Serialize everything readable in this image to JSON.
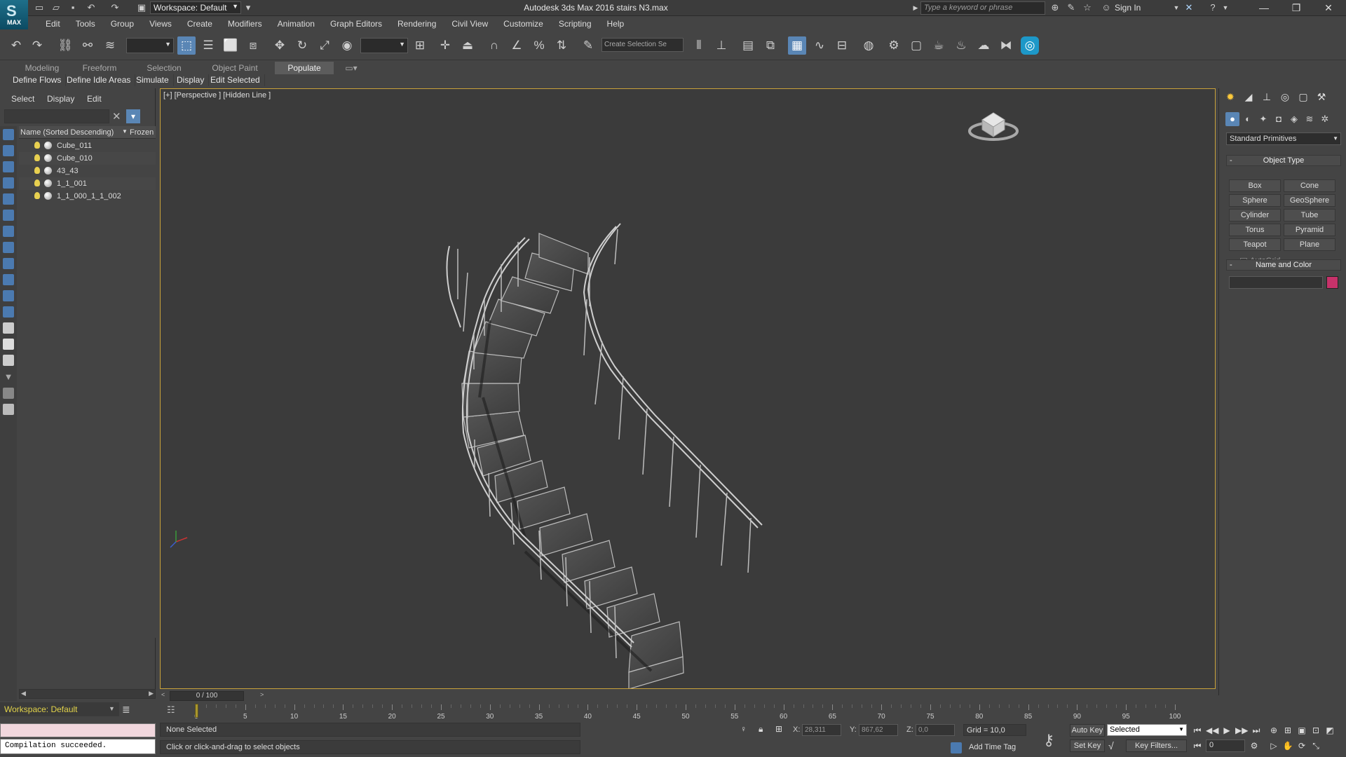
{
  "app": {
    "logo_text": "MAX",
    "title": "Autodesk 3ds Max 2016     stairs N3.max",
    "workspace": "Workspace: Default",
    "search_placeholder": "Type a keyword or phrase",
    "sign_in": "Sign In"
  },
  "menu": [
    "Edit",
    "Tools",
    "Group",
    "Views",
    "Create",
    "Modifiers",
    "Animation",
    "Graph Editors",
    "Rendering",
    "Civil View",
    "Customize",
    "Scripting",
    "Help"
  ],
  "toolbar": {
    "selection_set_placeholder": "Create Selection Se"
  },
  "ribbon": {
    "tabs": [
      "Modeling",
      "Freeform",
      "Selection",
      "Object Paint",
      "Populate"
    ],
    "active_tab": "Populate",
    "buttons": [
      "Define Flows",
      "Define Idle Areas",
      "Simulate",
      "Display",
      "Edit Selected"
    ]
  },
  "scene_explorer": {
    "menus": [
      "Select",
      "Display",
      "Edit"
    ],
    "column_name": "Name (Sorted Descending)",
    "column_frozen": "Frozen",
    "objects": [
      "Cube_011",
      "Cube_010",
      "43_43",
      "1_1_001",
      "1_1_000_1_1_002"
    ],
    "workspace": "Workspace: Default"
  },
  "maxscript": {
    "output": "Compilation succeeded."
  },
  "viewport": {
    "label": "[+] [Perspective ] [Hidden Line ]"
  },
  "command_panel": {
    "category": "Standard Primitives",
    "object_type_title": "Object Type",
    "autogrid_label": "AutoGrid",
    "primitives": [
      "Box",
      "Cone",
      "Sphere",
      "GeoSphere",
      "Cylinder",
      "Tube",
      "Torus",
      "Pyramid",
      "Teapot",
      "Plane"
    ],
    "name_color_title": "Name and Color",
    "object_color": "#c7326a"
  },
  "timeline": {
    "frame_display": "0 / 100",
    "tick_labels": [
      "0",
      "5",
      "10",
      "15",
      "20",
      "25",
      "30",
      "35",
      "40",
      "45",
      "50",
      "55",
      "60",
      "65",
      "70",
      "75",
      "80",
      "85",
      "90",
      "95",
      "100"
    ],
    "start": 0,
    "end": 100,
    "current": 0
  },
  "status": {
    "selection": "None Selected",
    "prompt": "Click or click-and-drag to select objects",
    "x_label": "X:",
    "x_value": "28,311",
    "y_label": "Y:",
    "y_value": "867,62",
    "z_label": "Z:",
    "z_value": "0,0",
    "grid": "Grid = 10,0",
    "add_time_tag": "Add Time Tag",
    "auto_key": "Auto Key",
    "set_key": "Set Key",
    "key_mode": "Selected",
    "key_filters": "Key Filters...",
    "frame_field": "0"
  }
}
